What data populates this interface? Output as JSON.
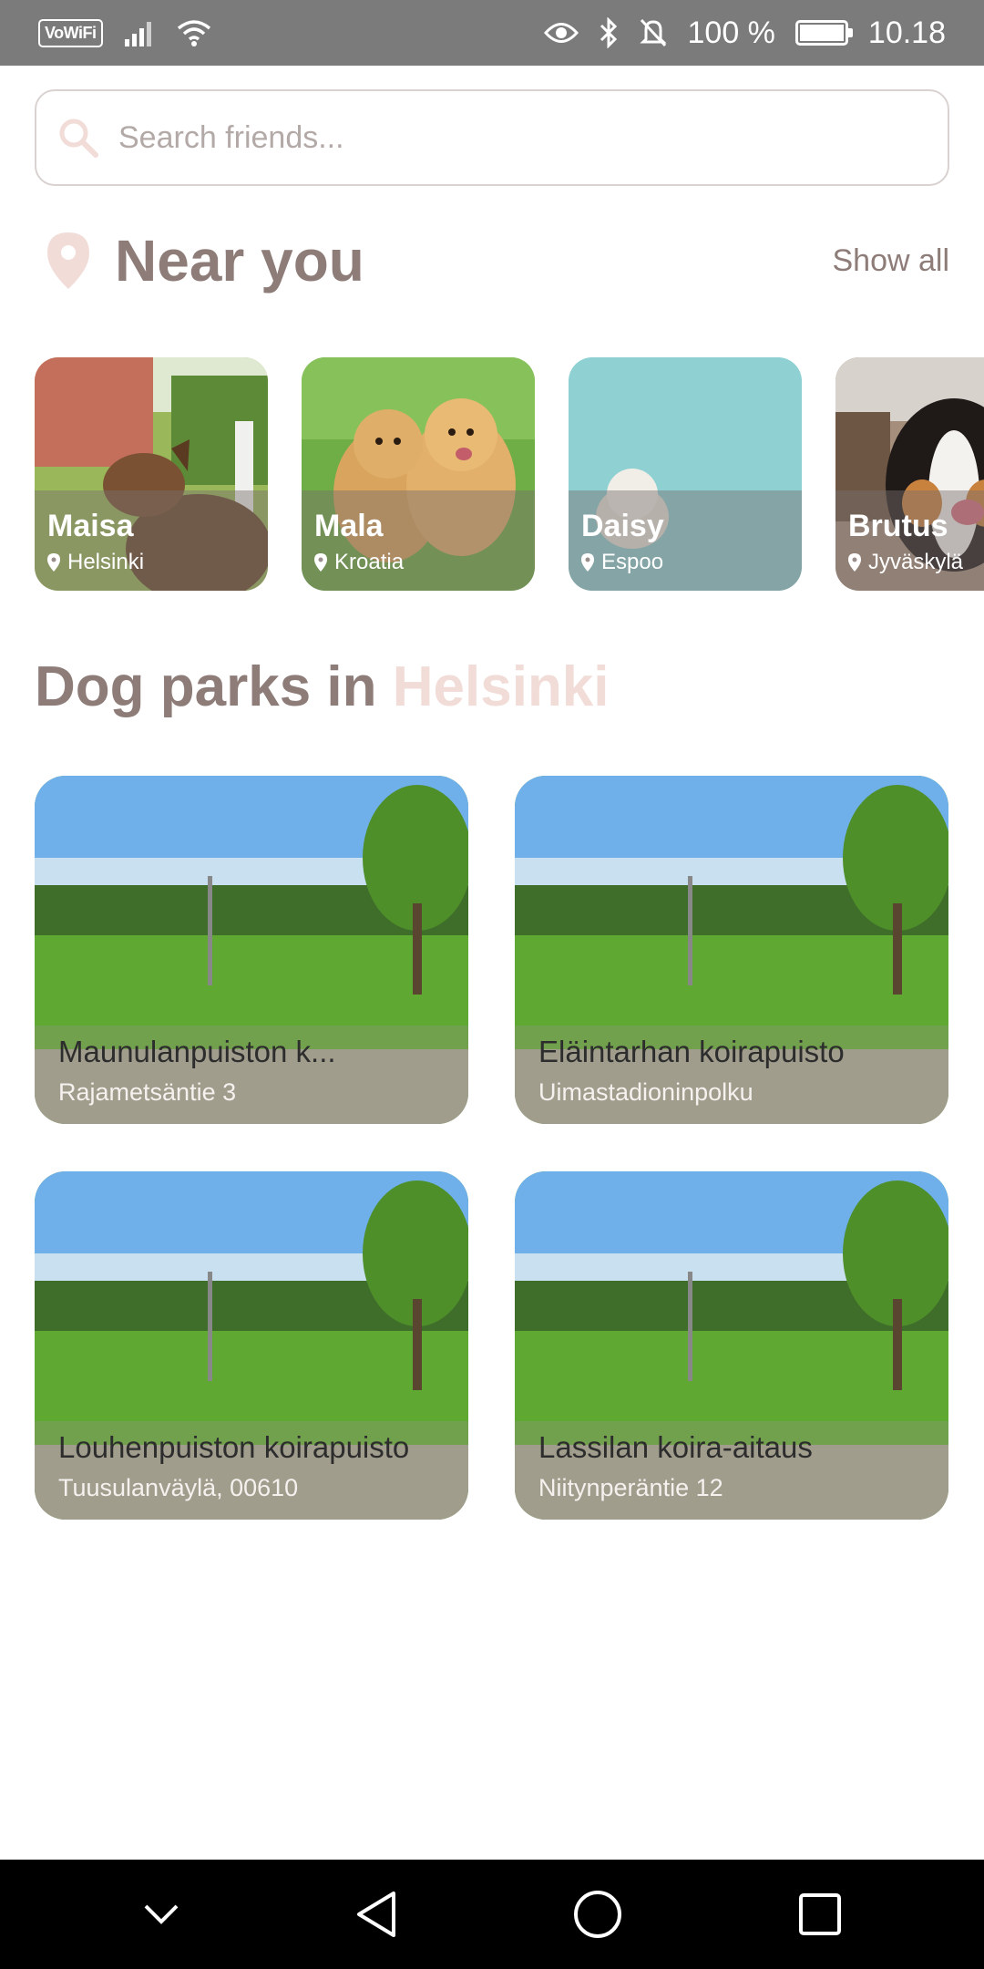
{
  "status_bar": {
    "vowifi": "VoWiFi",
    "battery": "100 %",
    "time": "10.18",
    "battery_level": 1.0
  },
  "search": {
    "placeholder": "Search friends..."
  },
  "near_you": {
    "title": "Near you",
    "show_all": "Show all",
    "friends": [
      {
        "name": "Maisa",
        "location": "Helsinki"
      },
      {
        "name": "Mala",
        "location": "Kroatia"
      },
      {
        "name": "Daisy",
        "location": "Espoo"
      },
      {
        "name": "Brutus",
        "location": "Jyväskylä"
      }
    ]
  },
  "dog_parks": {
    "title_prefix": "Dog parks in ",
    "city": "Helsinki",
    "parks": [
      {
        "name": "Maunulanpuiston k...",
        "address": "Rajametsäntie 3"
      },
      {
        "name": "Eläintarhan koirapuisto",
        "address": "Uimastadioninpolku"
      },
      {
        "name": "Louhenpuiston koirapuisto",
        "address": "Tuusulanväylä,  00610"
      },
      {
        "name": "Lassilan koira-aitaus",
        "address": "Niitynperäntie 12"
      }
    ]
  },
  "colors": {
    "accent": "#f1dcd8",
    "text": "#8d7c78",
    "status_bar": "#7b7b7b",
    "nav_bar": "#000000"
  }
}
